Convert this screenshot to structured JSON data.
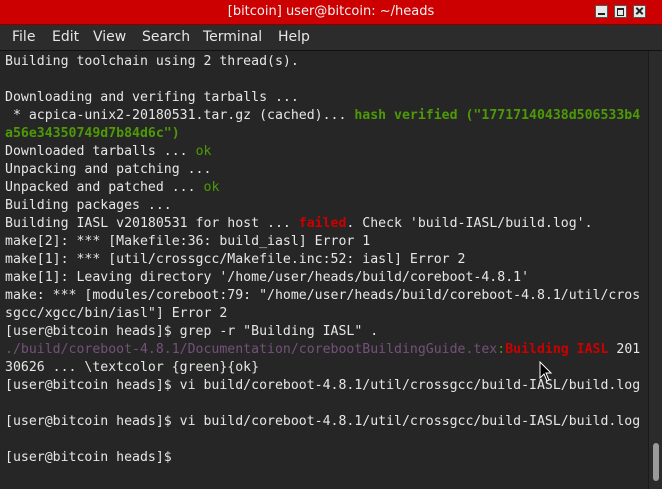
{
  "window": {
    "title": "[bitcoin] user@bitcoin: ~/heads",
    "buttons": {
      "minimize": "minimize",
      "maximize": "maximize",
      "close": "close"
    }
  },
  "menu": {
    "file": "File",
    "edit": "Edit",
    "view": "View",
    "search": "Search",
    "terminal": "Terminal",
    "help": "Help"
  },
  "terminal": {
    "l01": "Building toolchain using 2 thread(s).",
    "l03": "Downloading and verifing tarballs ...",
    "l04a": " * acpica-unix2-20180531.tar.gz (cached)... ",
    "l04b": "hash verified (\"17717140438d506533b4",
    "l05": "a56e34350749d7b84d6c\")",
    "l06a": "Downloaded tarballs ... ",
    "l06b": "ok",
    "l07": "Unpacking and patching ...",
    "l08a": "Unpacked and patched ... ",
    "l08b": "ok",
    "l09": "Building packages ...",
    "l10a": "Building IASL v20180531 for host ... ",
    "l10b": "failed",
    "l10c": ". Check 'build-IASL/build.log'.",
    "l11": "make[2]: *** [Makefile:36: build_iasl] Error 1",
    "l12": "make[1]: *** [util/crossgcc/Makefile.inc:52: iasl] Error 2",
    "l13": "make[1]: Leaving directory '/home/user/heads/build/coreboot-4.8.1'",
    "l14": "make: *** [modules/coreboot:79: \"/home/user/heads/build/coreboot-4.8.1/util/cros",
    "l15": "sgcc/xgcc/bin/iasl\"] Error 2",
    "l16": "[user@bitcoin heads]$ grep -r \"Building IASL\" .",
    "l17a": "./build/coreboot-4.8.1/Documentation/corebootBuildingGuide.tex",
    "l17b": ":",
    "l17c": "Building IASL",
    "l17d": " 201",
    "l18": "30626 ... \\textcolor {green}{ok}",
    "l19": "[user@bitcoin heads]$ vi build/coreboot-4.8.1/util/crossgcc/build-IASL/build.log",
    "l21": "[user@bitcoin heads]$ vi build/coreboot-4.8.1/util/crossgcc/build-IASL/build.log",
    "l23": "[user@bitcoin heads]$ "
  },
  "colors": {
    "titlebar": "#cc0000",
    "ok_green": "#4e9a06",
    "error_red": "#cc0000",
    "path_purple": "#75507b",
    "background": "#262626"
  },
  "icons": {
    "minimize": "minimize-icon",
    "maximize": "maximize-icon",
    "close": "close-icon",
    "cursor": "mouse-pointer-icon"
  }
}
